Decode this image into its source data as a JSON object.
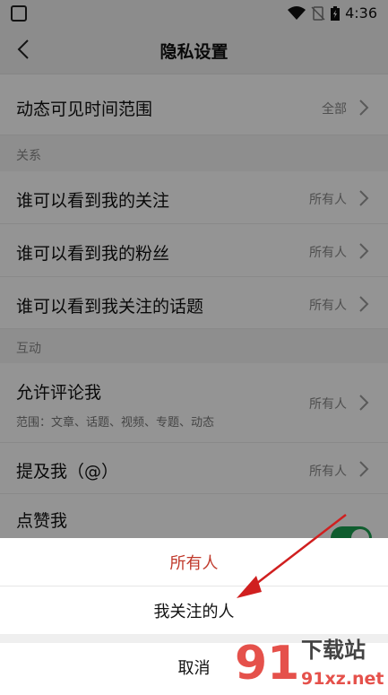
{
  "status_bar": {
    "time": "4:36"
  },
  "header": {
    "title": "隐私设置"
  },
  "rows": {
    "visibility_range": {
      "label": "动态可见时间范围",
      "value": "全部"
    },
    "section_relations": "关系",
    "who_see_following": {
      "label": "谁可以看到我的关注",
      "value": "所有人"
    },
    "who_see_fans": {
      "label": "谁可以看到我的粉丝",
      "value": "所有人"
    },
    "who_see_topics": {
      "label": "谁可以看到我关注的话题",
      "value": "所有人"
    },
    "section_interaction": "互动",
    "allow_comment": {
      "label": "允许评论我",
      "sub": "范围：文章、话题、视频、专题、动态",
      "value": "所有人"
    },
    "mention_me": {
      "label": "提及我（@）",
      "value": "所有人"
    },
    "like_me": {
      "label": "点赞我",
      "toggle_on": true
    }
  },
  "sheet": {
    "options": [
      "所有人",
      "我关注的人"
    ],
    "selected_index": 0,
    "cancel": "取消"
  },
  "watermark": {
    "text": "91xz.net",
    "brand": "下载站",
    "digits": "91"
  },
  "colors": {
    "accent_red": "#c0392b",
    "toggle_green": "#1aa150",
    "annotation_red": "#d01f1f"
  }
}
